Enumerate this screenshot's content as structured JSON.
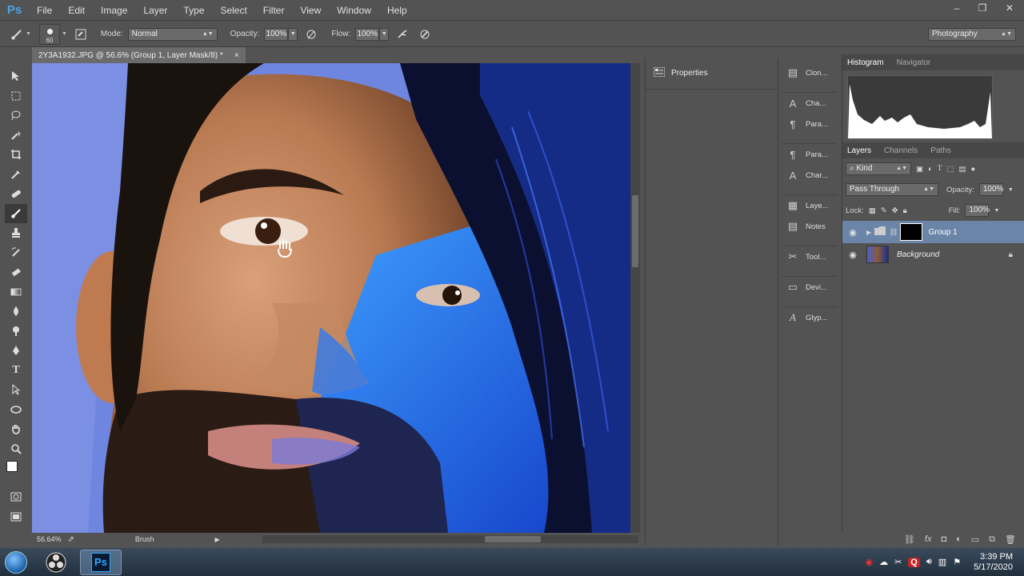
{
  "app": {
    "logo": "Ps"
  },
  "menu": [
    "File",
    "Edit",
    "Image",
    "Layer",
    "Type",
    "Select",
    "Filter",
    "View",
    "Window",
    "Help"
  ],
  "window_controls": {
    "minimize": "–",
    "restore": "❐",
    "close": "✕"
  },
  "options": {
    "brush_size": "60",
    "mode_label": "Mode:",
    "mode_value": "Normal",
    "opacity_label": "Opacity:",
    "opacity_value": "100%",
    "flow_label": "Flow:",
    "flow_value": "100%",
    "workspace": "Photography"
  },
  "document": {
    "tab_title": "2Y3A1932.JPG @ 56.6% (Group 1, Layer Mask/8) *",
    "close": "×",
    "zoom": "56.64%",
    "status_tool": "Brush"
  },
  "tools": [
    "move-tool",
    "marquee-tool",
    "lasso-tool",
    "magic-wand-tool",
    "crop-tool",
    "eyedropper-tool",
    "healing-tool",
    "brush-tool",
    "stamp-tool",
    "history-brush-tool",
    "eraser-tool",
    "gradient-tool",
    "blur-tool",
    "dodge-tool",
    "pen-tool",
    "type-tool",
    "path-selection-tool",
    "ellipse-tool",
    "hand-tool",
    "zoom-tool"
  ],
  "properties": {
    "title": "Properties"
  },
  "dock": {
    "group1": [
      {
        "icon": "clone-source-icon",
        "label": "Clon..."
      }
    ],
    "group2": [
      {
        "icon": "character-icon",
        "label": "Cha..."
      },
      {
        "icon": "paragraph-icon",
        "label": "Para..."
      }
    ],
    "group3": [
      {
        "icon": "paragraph-styles-icon",
        "label": "Para..."
      },
      {
        "icon": "character-styles-icon",
        "label": "Char..."
      }
    ],
    "group4": [
      {
        "icon": "layer-comps-icon",
        "label": "Laye..."
      },
      {
        "icon": "notes-icon",
        "label": "Notes"
      }
    ],
    "group5": [
      {
        "icon": "tool-presets-icon",
        "label": "Tool..."
      }
    ],
    "group6": [
      {
        "icon": "device-preview-icon",
        "label": "Devi..."
      }
    ],
    "group7": [
      {
        "icon": "glyphs-icon",
        "label": "Glyp..."
      }
    ]
  },
  "histogram": {
    "tab_active": "Histogram",
    "tab_other": "Navigator"
  },
  "layers_panel": {
    "tabs": [
      "Layers",
      "Channels",
      "Paths"
    ],
    "kind": "Kind",
    "blend": "Pass Through",
    "opacity_label": "Opacity:",
    "opacity_value": "100%",
    "lock_label": "Lock:",
    "fill_label": "Fill:",
    "fill_value": "100%",
    "layers": [
      {
        "name": "Group 1",
        "selected": true
      },
      {
        "name": "Background",
        "selected": false
      }
    ]
  },
  "taskbar": {
    "time": "3:39 PM",
    "date": "5/17/2020"
  }
}
